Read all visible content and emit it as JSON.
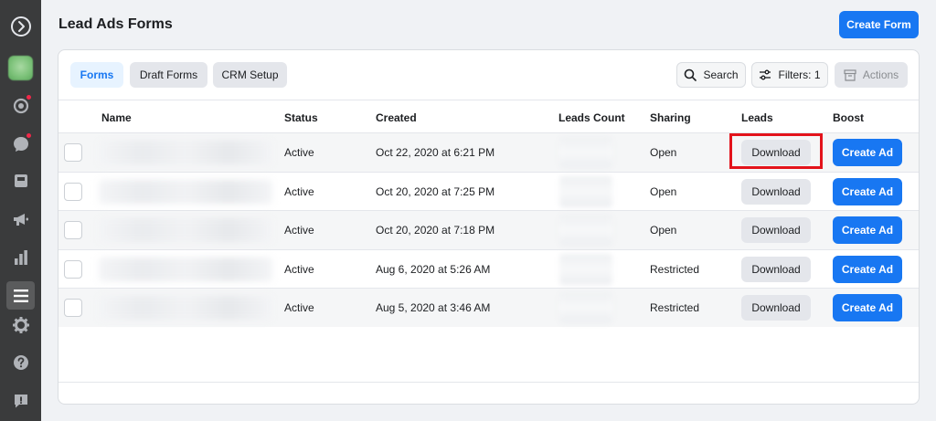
{
  "page": {
    "title": "Lead Ads Forms"
  },
  "header": {
    "create_form_label": "Create Form"
  },
  "tabs": [
    {
      "label": "Forms",
      "active": true
    },
    {
      "label": "Draft Forms",
      "active": false
    },
    {
      "label": "CRM Setup",
      "active": false
    }
  ],
  "toolbar": {
    "search_label": "Search",
    "filters_label": "Filters: 1",
    "actions_label": "Actions"
  },
  "table": {
    "columns": [
      "Name",
      "Status",
      "Created",
      "Leads Count",
      "Sharing",
      "Leads",
      "Boost"
    ],
    "rows": [
      {
        "status": "Active",
        "created": "Oct 22, 2020 at 6:21 PM",
        "sharing": "Open",
        "download_label": "Download",
        "boost_label": "Create Ad"
      },
      {
        "status": "Active",
        "created": "Oct 20, 2020 at 7:25 PM",
        "sharing": "Open",
        "download_label": "Download",
        "boost_label": "Create Ad"
      },
      {
        "status": "Active",
        "created": "Oct 20, 2020 at 7:18 PM",
        "sharing": "Open",
        "download_label": "Download",
        "boost_label": "Create Ad"
      },
      {
        "status": "Active",
        "created": "Aug 6, 2020 at 5:26 AM",
        "sharing": "Restricted",
        "download_label": "Download",
        "boost_label": "Create Ad"
      },
      {
        "status": "Active",
        "created": "Aug 5, 2020 at 3:46 AM",
        "sharing": "Restricted",
        "download_label": "Download",
        "boost_label": "Create Ad"
      }
    ]
  },
  "sidebar": {
    "icons": [
      "expand-icon",
      "avatar",
      "activity-icon",
      "messages-icon",
      "pages-icon",
      "megaphone-icon",
      "insights-icon",
      "menu-icon",
      "settings-icon",
      "help-icon",
      "report-icon"
    ]
  },
  "colors": {
    "accent": "#1877f2",
    "highlight": "#e3131b",
    "rail": "#3a3b3c"
  }
}
